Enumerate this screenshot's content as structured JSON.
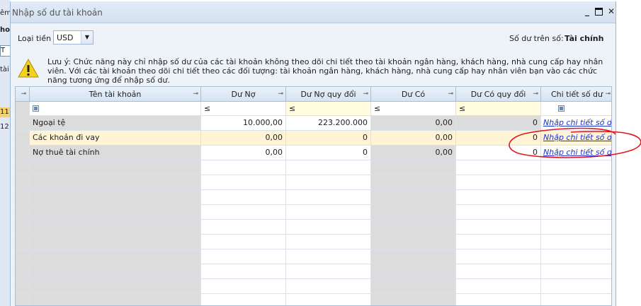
{
  "background": {
    "fragments": [
      "êm",
      "ho",
      "T",
      "tài",
      "11",
      "12"
    ]
  },
  "dialog": {
    "title": "Nhập số dư tài khoản",
    "currency_label": "Loại tiền",
    "currency_value": "USD",
    "balance_label": "Số dư trên số:",
    "balance_value": "Tài chính",
    "note": "Lưu ý: Chức năng này chỉ nhập số dư của các tài khoản không theo dõi chi tiết theo tài khoản ngân hàng, khách hàng, nhà cung cấp hay nhân viên. Với các tài khoản theo dõi chi tiết theo các đối tượng: tài khoản ngân hàng, khách hàng, nhà cung cấp hay nhân viên bạn vào các chức năng tương ứng để nhập số dư."
  },
  "grid": {
    "columns": [
      "Tên tài khoản",
      "Dư Nợ",
      "Dư Nợ quy đổi",
      "Dư Có",
      "Dư Có quy đổi",
      "Chi tiết số dư"
    ],
    "filter_op": "≤",
    "rows": [
      {
        "name": "Ngoại tệ",
        "debit": "10.000,00",
        "debit_conv": "223.200.000",
        "credit": "0,00",
        "credit_conv": "0",
        "detail": "Nhập chi tiết số dư"
      },
      {
        "name": "Các khoản đi vay",
        "debit": "0,00",
        "debit_conv": "0",
        "credit": "0,00",
        "credit_conv": "0",
        "detail": "Nhập chi tiết số dư"
      },
      {
        "name": "Nợ thuê tài chính",
        "debit": "0,00",
        "debit_conv": "0",
        "credit": "0,00",
        "credit_conv": "0",
        "detail": "Nhập chi tiết số dư"
      }
    ]
  },
  "colors": {
    "annotation": "#e0161b",
    "link": "#1a33c8",
    "selected_row": "#fff5d6"
  }
}
